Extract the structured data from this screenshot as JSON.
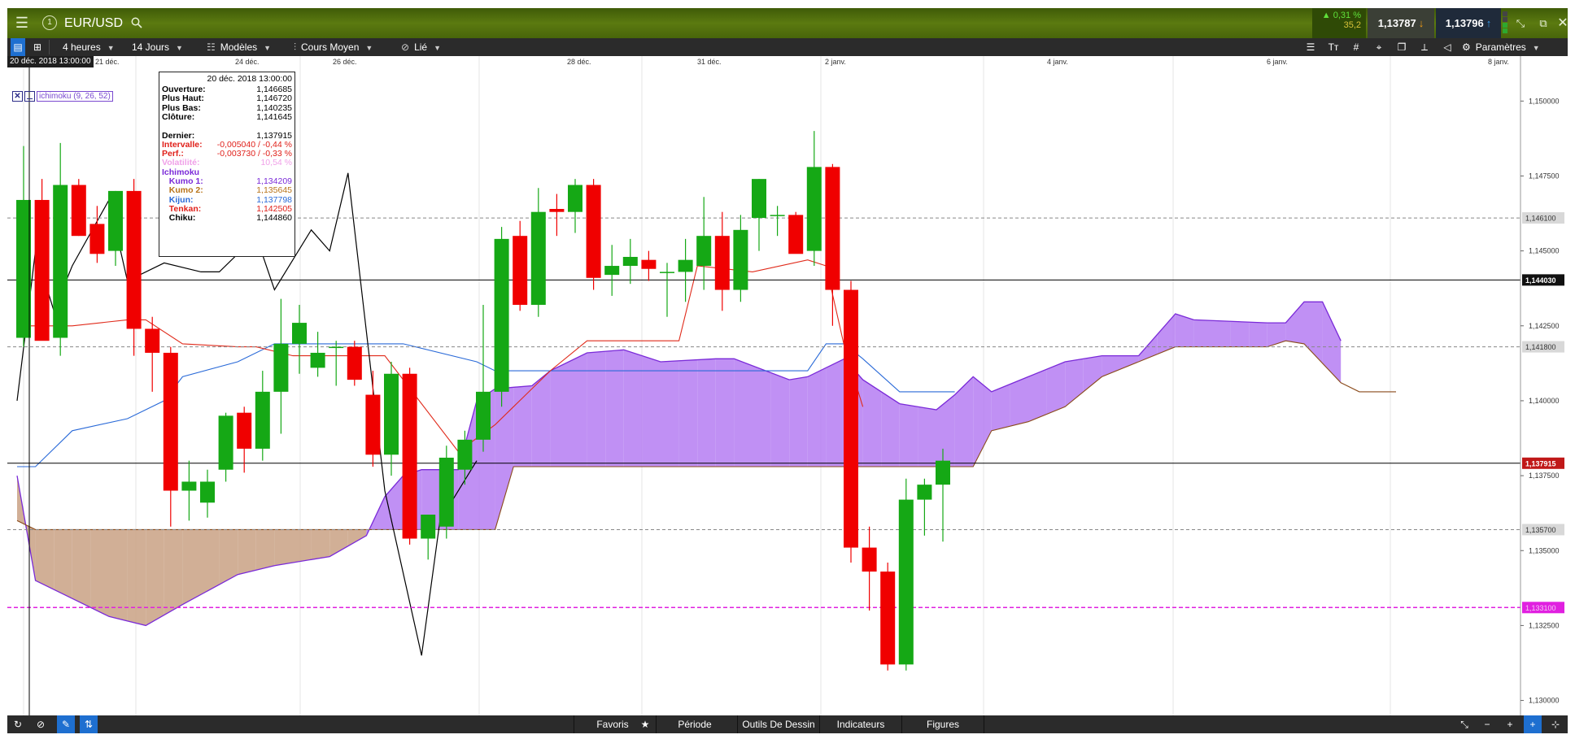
{
  "header": {
    "symbol": "EUR/USD",
    "badge": "1",
    "change_pct": "▲ 0,31 %",
    "change_pts": "35,2",
    "sell_price": "1,13787",
    "buy_price": "1,13796"
  },
  "toolbar": {
    "interval": "4 heures",
    "period": "14 Jours",
    "templates": "Modèles",
    "chart_type": "Cours Moyen",
    "link": "Lié",
    "settings": "Paramètres"
  },
  "crosshair": {
    "date_label": "20 déc. 2018 13:00:00"
  },
  "indicator_legend": {
    "name": "ichimoku (9, 26, 52)"
  },
  "infobox": {
    "title": "20 déc. 2018 13:00:00",
    "rows": [
      {
        "label": "Ouverture:",
        "value": "1,146685",
        "color": "#000000"
      },
      {
        "label": "Plus Haut:",
        "value": "1,146720",
        "color": "#000000"
      },
      {
        "label": "Plus Bas:",
        "value": "1,140235",
        "color": "#000000"
      },
      {
        "label": "Clôture:",
        "value": "1,141645",
        "color": "#000000"
      },
      {
        "label": "",
        "value": "",
        "color": "#000000"
      },
      {
        "label": "Dernier:",
        "value": "1,137915",
        "color": "#000000"
      },
      {
        "label": "Intervalle:",
        "value": "-0,005040 / -0,44 %",
        "color": "#e0201a"
      },
      {
        "label": "Perf.:",
        "value": "-0,003730 / -0,33 %",
        "color": "#e0201a"
      },
      {
        "label": "Volatilité:",
        "value": "10,54 %",
        "color": "#f0a0e8"
      },
      {
        "label": "Ichimoku",
        "value": "",
        "color": "#7a2ad8"
      },
      {
        "label": "  Kumo 1:",
        "value": "1,134209",
        "color": "#7a2ad8"
      },
      {
        "label": "  Kumo 2:",
        "value": "1,135645",
        "color": "#b8741a"
      },
      {
        "label": "  Kijun:",
        "value": "1,137798",
        "color": "#2a6ad8"
      },
      {
        "label": "  Tenkan:",
        "value": "1,142505",
        "color": "#e0201a"
      },
      {
        "label": "  Chiku:",
        "value": "1,144860",
        "color": "#000000"
      }
    ]
  },
  "bottombar": {
    "favorites": "Favoris",
    "period": "Période",
    "drawing_tools": "Outils De Dessin",
    "indicators": "Indicateurs",
    "figures": "Figures"
  },
  "chart_data": {
    "type": "candlestick",
    "symbol": "EUR/USD",
    "x_tick_labels": [
      "21 déc.",
      "24 déc.",
      "26 déc.",
      "28 déc.",
      "31 déc.",
      "2 janv.",
      "4 janv.",
      "6 janv.",
      "8 janv."
    ],
    "y_tick_labels": [
      "1,150000",
      "1,147500",
      "1,145000",
      "1,142500",
      "1,140000",
      "1,137500",
      "1,135000",
      "1,132500",
      "1,130000"
    ],
    "ylim": [
      1.1295,
      1.1515
    ],
    "price_markers": [
      {
        "label": "1,146100",
        "value": 1.1461,
        "style": "dashed",
        "color": "#888888"
      },
      {
        "label": "1,144030",
        "value": 1.14403,
        "style": "solid",
        "color": "#000000"
      },
      {
        "label": "1,141800",
        "value": 1.1418,
        "style": "dashed",
        "color": "#888888"
      },
      {
        "label": "1,137915",
        "value": 1.137915,
        "style": "solid",
        "color": "#c01818"
      },
      {
        "label": "1,135700",
        "value": 1.1357,
        "style": "dashed",
        "color": "#888888"
      },
      {
        "label": "1,133100",
        "value": 1.1331,
        "style": "dashed",
        "color": "#e020e0"
      }
    ],
    "candles": [
      {
        "o": 1.1421,
        "h": 1.1485,
        "l": 1.1418,
        "c": 1.1467
      },
      {
        "o": 1.1467,
        "h": 1.1474,
        "l": 1.1421,
        "c": 1.142
      },
      {
        "o": 1.1421,
        "h": 1.1486,
        "l": 1.1415,
        "c": 1.1472
      },
      {
        "o": 1.1472,
        "h": 1.1474,
        "l": 1.1455,
        "c": 1.1455
      },
      {
        "o": 1.1459,
        "h": 1.1465,
        "l": 1.1446,
        "c": 1.1449
      },
      {
        "o": 1.145,
        "h": 1.147,
        "l": 1.1445,
        "c": 1.147
      },
      {
        "o": 1.147,
        "h": 1.1474,
        "l": 1.1415,
        "c": 1.1424
      },
      {
        "o": 1.1424,
        "h": 1.1428,
        "l": 1.1403,
        "c": 1.1416
      },
      {
        "o": 1.1416,
        "h": 1.1418,
        "l": 1.1358,
        "c": 1.137
      },
      {
        "o": 1.137,
        "h": 1.138,
        "l": 1.136,
        "c": 1.1373
      },
      {
        "o": 1.1366,
        "h": 1.1377,
        "l": 1.1361,
        "c": 1.1373
      },
      {
        "o": 1.1377,
        "h": 1.1396,
        "l": 1.1373,
        "c": 1.1395
      },
      {
        "o": 1.1396,
        "h": 1.1398,
        "l": 1.1376,
        "c": 1.1384
      },
      {
        "o": 1.1384,
        "h": 1.141,
        "l": 1.138,
        "c": 1.1403
      },
      {
        "o": 1.1403,
        "h": 1.1434,
        "l": 1.1389,
        "c": 1.1419
      },
      {
        "o": 1.1419,
        "h": 1.1432,
        "l": 1.1409,
        "c": 1.1426
      },
      {
        "o": 1.1411,
        "h": 1.1423,
        "l": 1.1408,
        "c": 1.1416
      },
      {
        "o": 1.1418,
        "h": 1.142,
        "l": 1.1405,
        "c": 1.1418
      },
      {
        "o": 1.1418,
        "h": 1.142,
        "l": 1.1405,
        "c": 1.1407
      },
      {
        "o": 1.1402,
        "h": 1.141,
        "l": 1.1378,
        "c": 1.1382
      },
      {
        "o": 1.1382,
        "h": 1.1413,
        "l": 1.1375,
        "c": 1.1409
      },
      {
        "o": 1.1409,
        "h": 1.1411,
        "l": 1.1352,
        "c": 1.1354
      },
      {
        "o": 1.1354,
        "h": 1.1362,
        "l": 1.1347,
        "c": 1.1362
      },
      {
        "o": 1.1358,
        "h": 1.1385,
        "l": 1.1354,
        "c": 1.1381
      },
      {
        "o": 1.1377,
        "h": 1.139,
        "l": 1.1372,
        "c": 1.1387
      },
      {
        "o": 1.1387,
        "h": 1.1432,
        "l": 1.1383,
        "c": 1.1403
      },
      {
        "o": 1.1403,
        "h": 1.1458,
        "l": 1.1398,
        "c": 1.1454
      },
      {
        "o": 1.1455,
        "h": 1.146,
        "l": 1.143,
        "c": 1.1432
      },
      {
        "o": 1.1432,
        "h": 1.1471,
        "l": 1.1428,
        "c": 1.1463
      },
      {
        "o": 1.1464,
        "h": 1.1469,
        "l": 1.1455,
        "c": 1.1463
      },
      {
        "o": 1.1463,
        "h": 1.1474,
        "l": 1.1456,
        "c": 1.1472
      },
      {
        "o": 1.1472,
        "h": 1.1474,
        "l": 1.1437,
        "c": 1.1441
      },
      {
        "o": 1.1442,
        "h": 1.1452,
        "l": 1.1435,
        "c": 1.1445
      },
      {
        "o": 1.1445,
        "h": 1.1454,
        "l": 1.1439,
        "c": 1.1448
      },
      {
        "o": 1.1447,
        "h": 1.145,
        "l": 1.144,
        "c": 1.1444
      },
      {
        "o": 1.1443,
        "h": 1.1446,
        "l": 1.1428,
        "c": 1.1443
      },
      {
        "o": 1.1443,
        "h": 1.1454,
        "l": 1.1433,
        "c": 1.1447
      },
      {
        "o": 1.1445,
        "h": 1.1468,
        "l": 1.1437,
        "c": 1.1455
      },
      {
        "o": 1.1455,
        "h": 1.1463,
        "l": 1.143,
        "c": 1.1437
      },
      {
        "o": 1.1437,
        "h": 1.1462,
        "l": 1.1433,
        "c": 1.1457
      },
      {
        "o": 1.1461,
        "h": 1.1474,
        "l": 1.145,
        "c": 1.1474
      },
      {
        "o": 1.1462,
        "h": 1.1465,
        "l": 1.1455,
        "c": 1.1462
      },
      {
        "o": 1.1462,
        "h": 1.1463,
        "l": 1.145,
        "c": 1.1449
      },
      {
        "o": 1.145,
        "h": 1.149,
        "l": 1.1445,
        "c": 1.1478
      },
      {
        "o": 1.1478,
        "h": 1.1479,
        "l": 1.1425,
        "c": 1.1437
      },
      {
        "o": 1.1437,
        "h": 1.144,
        "l": 1.1346,
        "c": 1.1351
      },
      {
        "o": 1.1351,
        "h": 1.1358,
        "l": 1.133,
        "c": 1.1343
      },
      {
        "o": 1.1343,
        "h": 1.1346,
        "l": 1.131,
        "c": 1.1312
      },
      {
        "o": 1.1312,
        "h": 1.1374,
        "l": 1.131,
        "c": 1.1367
      },
      {
        "o": 1.1367,
        "h": 1.1374,
        "l": 1.1355,
        "c": 1.1372
      },
      {
        "o": 1.1372,
        "h": 1.1384,
        "l": 1.1353,
        "c": 1.138
      }
    ],
    "series": [
      {
        "name": "Tenkan",
        "color": "#e02a1a"
      },
      {
        "name": "Kijun",
        "color": "#2a6ad8"
      },
      {
        "name": "Chiku",
        "color": "#000000"
      },
      {
        "name": "Kumo 1",
        "color": "#7a2ad8"
      },
      {
        "name": "Kumo 2",
        "color": "#8a4a1a"
      }
    ],
    "tenkan": [
      [
        0,
        1.1425
      ],
      [
        3,
        1.1425
      ],
      [
        6,
        1.1427
      ],
      [
        7,
        1.1427
      ],
      [
        9,
        1.1419
      ],
      [
        12,
        1.1418
      ],
      [
        13,
        1.1418
      ],
      [
        15,
        1.1415
      ],
      [
        20,
        1.1415
      ],
      [
        24,
        1.1383
      ],
      [
        26,
        1.1392
      ],
      [
        27,
        1.1398
      ],
      [
        29,
        1.141
      ],
      [
        31,
        1.142
      ],
      [
        36,
        1.142
      ],
      [
        37,
        1.1445
      ],
      [
        40,
        1.1443
      ],
      [
        43,
        1.1447
      ],
      [
        44,
        1.1445
      ],
      [
        45,
        1.1418
      ],
      [
        46,
        1.1398
      ]
    ],
    "kijun": [
      [
        0,
        1.1378
      ],
      [
        1,
        1.1378
      ],
      [
        3,
        1.139
      ],
      [
        6,
        1.1394
      ],
      [
        8,
        1.14
      ],
      [
        9,
        1.1408
      ],
      [
        12,
        1.1413
      ],
      [
        14,
        1.1419
      ],
      [
        21,
        1.1419
      ],
      [
        25,
        1.1413
      ],
      [
        26,
        1.141
      ],
      [
        27,
        1.141
      ],
      [
        43,
        1.141
      ],
      [
        44,
        1.1419
      ],
      [
        45,
        1.1419
      ],
      [
        46,
        1.1414
      ],
      [
        48,
        1.1403
      ],
      [
        51,
        1.1403
      ]
    ],
    "chiku": [
      [
        0,
        1.14
      ],
      [
        1,
        1.145
      ],
      [
        2,
        1.143
      ],
      [
        3,
        1.1445
      ],
      [
        5,
        1.1467
      ],
      [
        6,
        1.144
      ],
      [
        8,
        1.1446
      ],
      [
        10,
        1.1443
      ],
      [
        11,
        1.1443
      ],
      [
        13,
        1.1455
      ],
      [
        14,
        1.1437
      ],
      [
        16,
        1.1457
      ],
      [
        17,
        1.145
      ],
      [
        18,
        1.1476
      ],
      [
        20,
        1.137
      ],
      [
        22,
        1.1315
      ],
      [
        23,
        1.136
      ],
      [
        25,
        1.138
      ]
    ],
    "kumo1": [
      [
        0,
        1.1375
      ],
      [
        1,
        1.134
      ],
      [
        3,
        1.1334
      ],
      [
        5,
        1.1328
      ],
      [
        7,
        1.1325
      ],
      [
        9,
        1.1332
      ],
      [
        12,
        1.1342
      ],
      [
        14,
        1.1345
      ],
      [
        17,
        1.1348
      ],
      [
        19,
        1.1355
      ],
      [
        20,
        1.1368
      ],
      [
        21,
        1.1375
      ],
      [
        22,
        1.1377
      ],
      [
        24,
        1.1377
      ],
      [
        25,
        1.14
      ],
      [
        26,
        1.1404
      ],
      [
        28,
        1.1405
      ],
      [
        29,
        1.141
      ],
      [
        31,
        1.1416
      ],
      [
        33,
        1.1417
      ],
      [
        35,
        1.1413
      ],
      [
        38,
        1.1414
      ],
      [
        39,
        1.1414
      ],
      [
        42,
        1.1407
      ],
      [
        43,
        1.1408
      ],
      [
        45,
        1.1414
      ],
      [
        46,
        1.1407
      ],
      [
        48,
        1.1399
      ],
      [
        50,
        1.1397
      ],
      [
        51,
        1.1402
      ],
      [
        52,
        1.1408
      ],
      [
        53,
        1.1403
      ],
      [
        55,
        1.1408
      ],
      [
        57,
        1.1413
      ],
      [
        59,
        1.1415
      ],
      [
        61,
        1.1415
      ],
      [
        63,
        1.1429
      ],
      [
        64,
        1.1427
      ],
      [
        68,
        1.1426
      ],
      [
        69,
        1.1426
      ],
      [
        70,
        1.1433
      ],
      [
        71,
        1.1433
      ],
      [
        72,
        1.142
      ]
    ],
    "kumo2": [
      [
        0,
        1.136
      ],
      [
        1,
        1.1357
      ],
      [
        26,
        1.1357
      ],
      [
        27,
        1.1378
      ],
      [
        28,
        1.1378
      ],
      [
        52,
        1.1378
      ],
      [
        53,
        1.139
      ],
      [
        55,
        1.1393
      ],
      [
        57,
        1.1398
      ],
      [
        59,
        1.1408
      ],
      [
        63,
        1.1418
      ],
      [
        68,
        1.1418
      ],
      [
        69,
        1.142
      ],
      [
        70,
        1.1419
      ],
      [
        72,
        1.1406
      ],
      [
        73,
        1.1403
      ],
      [
        75,
        1.1403
      ]
    ]
  }
}
